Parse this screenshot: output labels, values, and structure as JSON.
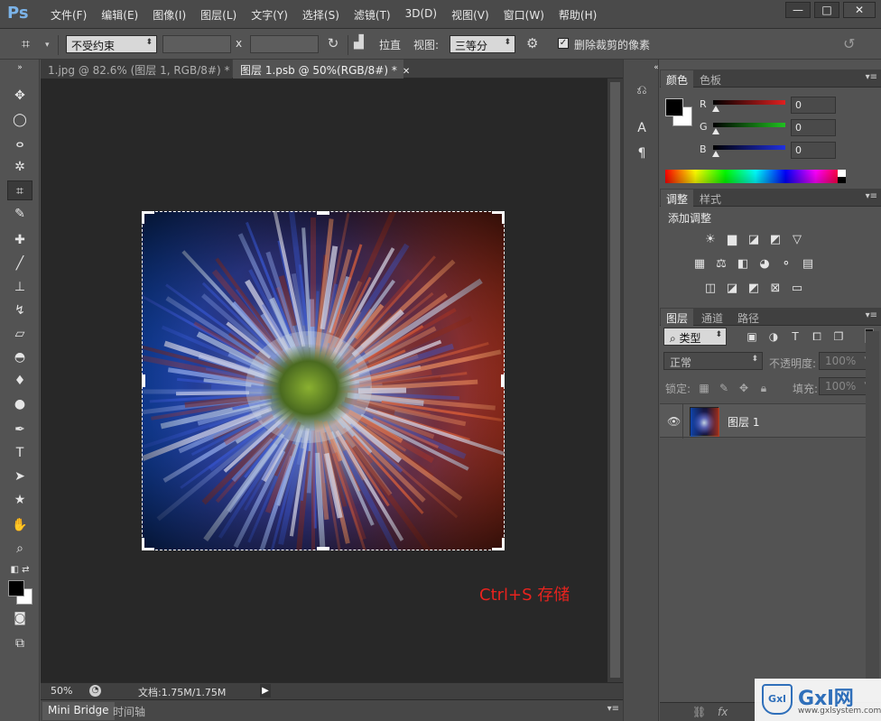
{
  "app": {
    "logo": "Ps"
  },
  "menu": [
    "文件(F)",
    "编辑(E)",
    "图像(I)",
    "图层(L)",
    "文字(Y)",
    "选择(S)",
    "滤镜(T)",
    "3D(D)",
    "视图(V)",
    "窗口(W)",
    "帮助(H)"
  ],
  "window_controls": {
    "minimize": "—",
    "restore": "□",
    "close": "✕"
  },
  "options": {
    "ratio_value": "不受约束",
    "x_label": "x",
    "straighten_label": "拉直",
    "view_label": "视图:",
    "view_value": "三等分",
    "delete_cropped_label": "删除裁剪的像素",
    "delete_cropped_checked": true
  },
  "doc_tabs": [
    {
      "label": "1.jpg @ 82.6% (图层 1, RGB/8#) *",
      "active": false
    },
    {
      "label": "图层 1.psb @ 50%(RGB/8#) *",
      "active": true
    }
  ],
  "canvas": {
    "hint": "Ctrl+S 存储",
    "hint_color": "#e8231e"
  },
  "status": {
    "zoom": "50%",
    "doc_size": "文档:1.75M/1.75M"
  },
  "bottom_tabs": [
    "Mini Bridge",
    "时间轴"
  ],
  "color_panel": {
    "tabs": [
      "颜色",
      "色板"
    ],
    "channels": [
      {
        "label": "R",
        "value": "0",
        "color": "#e02020"
      },
      {
        "label": "G",
        "value": "0",
        "color": "#20c020"
      },
      {
        "label": "B",
        "value": "0",
        "color": "#2030e0"
      }
    ],
    "foreground": "#000000",
    "background": "#ffffff"
  },
  "adjust_panel": {
    "tabs": [
      "调整",
      "样式"
    ],
    "title": "添加调整"
  },
  "layers_panel": {
    "tabs": [
      "图层",
      "通道",
      "路径"
    ],
    "filter_kind": "类型",
    "blend_mode": "正常",
    "opacity_label": "不透明度:",
    "opacity_value": "100%",
    "lock_label": "锁定:",
    "fill_label": "填充:",
    "fill_value": "100%",
    "layers": [
      {
        "name": "图层 1",
        "visible": true
      }
    ]
  },
  "watermark": {
    "text": "Gxl网",
    "url": "www.gxlsystem.com"
  }
}
